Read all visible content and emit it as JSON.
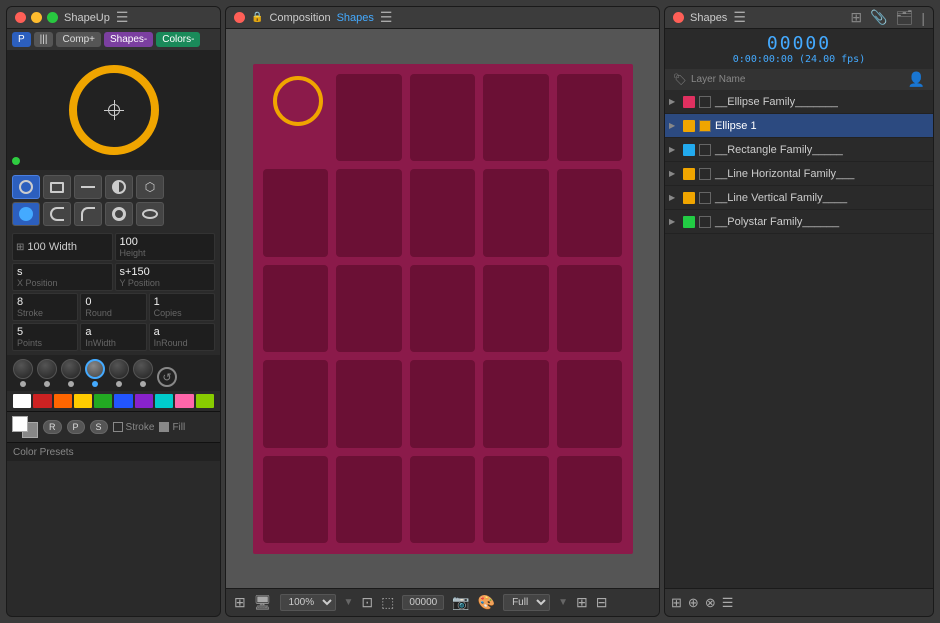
{
  "leftPanel": {
    "title": "ShapeUp",
    "tabs": {
      "p": "P",
      "bars": "|||",
      "comp": "Comp+",
      "shapes": "Shapes-",
      "colors": "Colors-"
    },
    "properties": {
      "width": {
        "value": "100",
        "label": "Width"
      },
      "height": {
        "value": "100",
        "label": "Height"
      },
      "xPosition": {
        "value": "s",
        "label": "X Position"
      },
      "yPosition": {
        "value": "s+150",
        "label": "Y Position"
      },
      "stroke": {
        "value": "8",
        "label": "Stroke"
      },
      "round": {
        "value": "0",
        "label": "Round"
      },
      "copies": {
        "value": "1",
        "label": "Copies"
      },
      "points": {
        "value": "5",
        "label": "Points"
      },
      "inWidth": {
        "value": "a",
        "label": "InWidth"
      },
      "inRound": {
        "value": "a",
        "label": "InRound"
      }
    },
    "colorPresets": {
      "label": "Color Presets",
      "swatches": [
        "#ffffff",
        "#cc2222",
        "#ff6600",
        "#ffcc00",
        "#22aa22",
        "#2255ff",
        "#8822cc",
        "#00cccc"
      ]
    },
    "bottomButtons": {
      "r": "R",
      "p": "P",
      "s": "S",
      "stroke": "Stroke",
      "fill": "Fill"
    }
  },
  "middlePanel": {
    "title": "Composition",
    "titleAccent": "Shapes",
    "zoom": "100%",
    "timecode": "00000",
    "quality": "Full"
  },
  "rightPanel": {
    "title": "Shapes",
    "timecodeMain": "00000",
    "timecodeSub": "0:00:00:00 (24.00 fps)",
    "layers": [
      {
        "id": 1,
        "name": "__Ellipse Family_______",
        "color": "#e03060",
        "selected": false,
        "expanded": false
      },
      {
        "id": 2,
        "name": "Ellipse 1",
        "color": "#f0a500",
        "selected": true,
        "expanded": false
      },
      {
        "id": 3,
        "name": "__Rectangle Family_____",
        "color": "#22aaee",
        "selected": false,
        "expanded": false
      },
      {
        "id": 4,
        "name": "__Line Horizontal Family___",
        "color": "#f0a500",
        "selected": false,
        "expanded": false
      },
      {
        "id": 5,
        "name": "__Line Vertical Family____",
        "color": "#f0a500",
        "selected": false,
        "expanded": false
      },
      {
        "id": 6,
        "name": "__Polystar Family______",
        "color": "#22cc44",
        "selected": false,
        "expanded": false
      }
    ],
    "columnLabel": "Layer Name"
  }
}
